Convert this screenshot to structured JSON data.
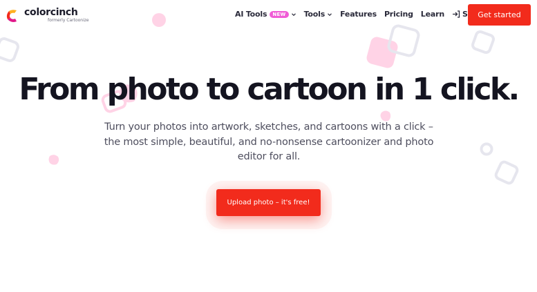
{
  "brand": {
    "name": "colorcinch",
    "tagline": "formerly Cartoonize",
    "logo_icon": "colorcinch-logo-icon"
  },
  "nav": {
    "items": [
      {
        "label": "AI Tools",
        "badge": "NEW",
        "has_dropdown": true
      },
      {
        "label": "Tools",
        "has_dropdown": true
      },
      {
        "label": "Features"
      },
      {
        "label": "Pricing"
      },
      {
        "label": "Learn"
      },
      {
        "label": "Sign in",
        "icon": "sign-in-icon"
      }
    ]
  },
  "header_cta": {
    "label": "Get started"
  },
  "hero": {
    "title": "From photo to cartoon in 1 click.",
    "subtitle": "Turn your photos into artwork, sketches, and cartoons with a click – the most simple, beautiful, and no-nonsense cartoonizer and photo editor for all.",
    "upload_button": "Upload photo – it's free!"
  },
  "colors": {
    "accent": "#f22b1c",
    "badge": "#f05cd6",
    "shape_pink": "#ffd3e6",
    "shape_outline": "#e6e6ee",
    "text_dark": "#141420",
    "text_muted": "#4e4e5e"
  }
}
